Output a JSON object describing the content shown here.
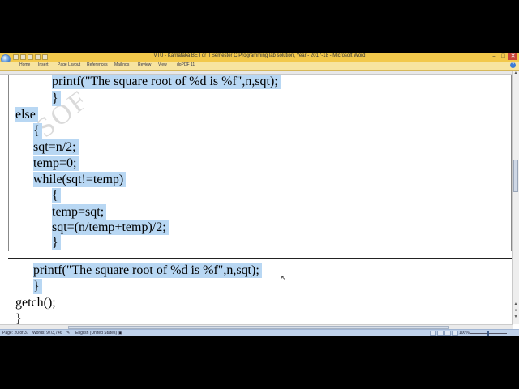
{
  "window": {
    "title": "VTU - Karnataka BE I or II Semester C Programming lab solution, Year - 2017-18  -  Microsoft Word",
    "minimize": "–",
    "maximize": "□",
    "close": "✕"
  },
  "tabs": [
    "Home",
    "Insert",
    "Page Layout",
    "References",
    "Mailings",
    "Review",
    "View",
    "doPDF 11"
  ],
  "code_lines": [
    "printf(\"The square root of %d is %f\",n,sqt);",
    "}",
    "else",
    "{",
    "sqt=n/2;",
    "temp=0;",
    "while(sqt!=temp)",
    "{",
    "temp=sqt;",
    "sqt=(n/temp+temp)/2;",
    "}",
    "printf(\"The square root of %d is %f\",n,sqt);",
    "}",
    "getch();",
    "}"
  ],
  "watermark": "SOF",
  "status": {
    "page": "Page: 20 of 37",
    "words": "Words: 97/3,746",
    "language": "English (United States)",
    "zoom": "100%"
  }
}
